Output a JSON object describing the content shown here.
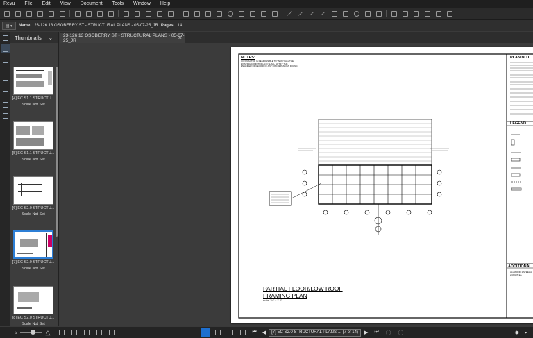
{
  "menu": [
    "Revu",
    "File",
    "Edit",
    "View",
    "Document",
    "Tools",
    "Window",
    "Help"
  ],
  "toolbar_icons": [
    "new-icon",
    "open-icon",
    "save-icon",
    "print-icon",
    "email-icon",
    "undo-icon",
    "redo-icon",
    "markup-icon",
    "text-icon",
    "highlight-icon",
    "callout-icon",
    "pen-icon",
    "line-icon",
    "arrow-icon",
    "rectangle-icon",
    "ellipse-icon",
    "polygon-icon",
    "cloud-icon",
    "measure-icon",
    "stamp-icon"
  ],
  "docbar": {
    "name_label": "Name:",
    "name_value": "23-126 13 OSOBERRY ST - STRUCTURAL PLANS - 05-07-25_JR",
    "pages_label": "Pages:",
    "pages_value": "14"
  },
  "panel": {
    "title": "Thumbnails",
    "thumbnails": [
      {
        "label": "[4] EC S1.1 STRUCTU...",
        "scale": "Scale Not Set"
      },
      {
        "label": "[5] EC S1.1 STRUCTU...",
        "scale": "Scale Not Set"
      },
      {
        "label": "[6] EC S2.0 STRUCTU...",
        "scale": "Scale Not Set"
      },
      {
        "label": "[7] EC S2.0 STRUCTU...",
        "scale": "Scale Not Set"
      },
      {
        "label": "[8] EC S2.0 STRUCTU...",
        "scale": "Scale Not Set"
      }
    ]
  },
  "tab": {
    "title": "23-126 13 OSOBERRY ST - STRUCTURAL PLANS - 05-07-25_JR",
    "close": "×"
  },
  "drawing": {
    "notes_title": "NOTES:",
    "notes_text": [
      "CONTRACTOR IS RESPONSIBLE TO VERIFY ALL THE",
      "EXISTING CONDITION AND SHALL NOTIFY THE",
      "ENGINEER OF RECORD IF ANY DISCREPANCIES FOUND."
    ],
    "plan_notes_title": "PLAN NOT",
    "legend_title": "LEGEND",
    "additional_title": "ADDITIONAL",
    "additional_text": [
      "ALL WOOD 1 STEEL A",
      "2 ROWS EA"
    ],
    "plan_title_1": "PARTIAL FLOOR/LOW ROOF",
    "plan_title_2": "FRAMING PLAN",
    "scale": "scale: 1/4\" = 1'-0\""
  },
  "status": {
    "page_nav": "[7] EC S2.0 STRUCTURAL PLANS-... (7 of 14)"
  }
}
